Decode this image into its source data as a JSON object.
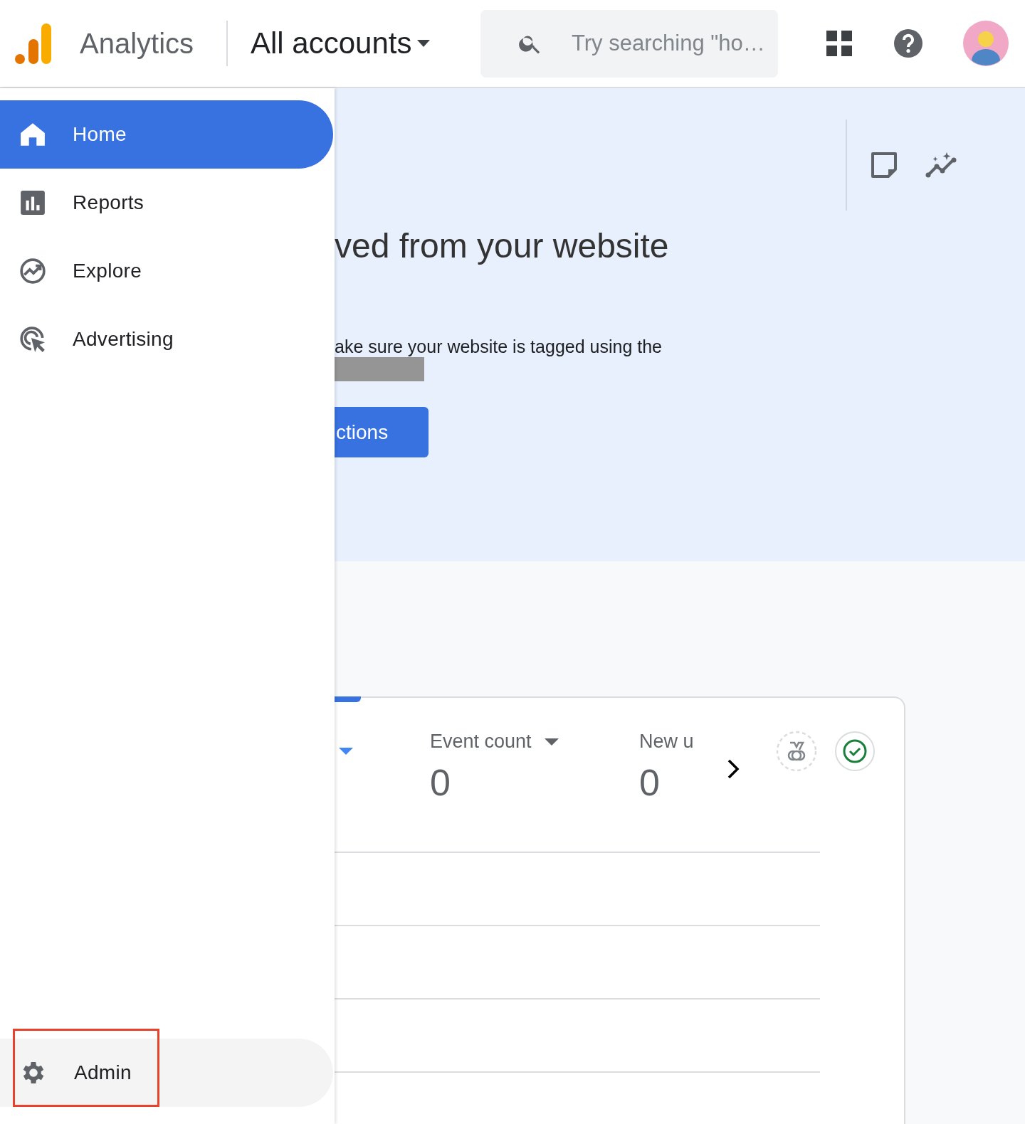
{
  "header": {
    "product": "Analytics",
    "account_selector": "All accounts",
    "search": {
      "placeholder": "Try searching \"ho…"
    }
  },
  "nav": {
    "items": [
      {
        "label": "Home",
        "selected": true
      },
      {
        "label": "Reports",
        "selected": false
      },
      {
        "label": "Explore",
        "selected": false
      },
      {
        "label": "Advertising",
        "selected": false
      }
    ],
    "admin": {
      "label": "Admin",
      "selected": false,
      "highlighted": true
    }
  },
  "banner": {
    "heading": "ved from your website",
    "body": "ake sure your website is tagged using the",
    "redacted": true,
    "button": "ctions"
  },
  "card": {
    "metrics": [
      {
        "label": "Event count",
        "value": "0",
        "dropdown": true
      },
      {
        "label": "New u",
        "value": "0",
        "dropdown": false
      }
    ]
  }
}
